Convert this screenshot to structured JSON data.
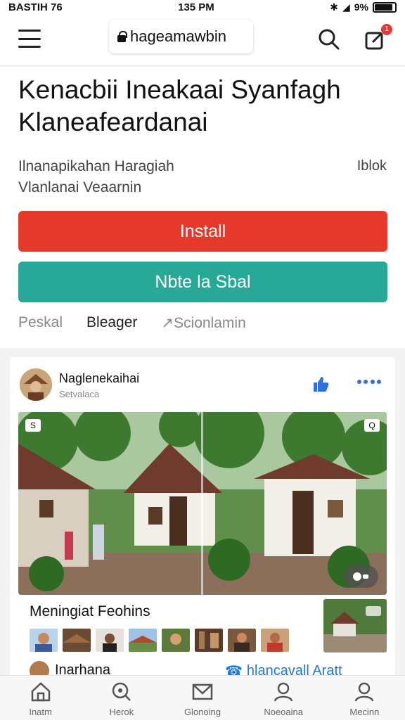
{
  "status_bar": {
    "left": "BASTIH 76",
    "time": "135 PM",
    "battery": "9%",
    "battery_level": 0.9
  },
  "app_bar": {
    "url": "hageamawbin",
    "notification_count": "1"
  },
  "hero": {
    "title": "Kenacbii Ineakaai Syanfagh Klaneafeardanai",
    "subtitle_line1": "Ilnanapikahan Haragiah",
    "subtitle_line2": "Vlanlanai Veaarnin",
    "side_link": "Iblok",
    "install_label": "Install",
    "secondary_label": "Nbte la Sbal",
    "tabs": [
      "Peskal",
      "Bleager",
      "Scionlamin"
    ]
  },
  "post": {
    "author": "Naglenekaihai",
    "author_sub": "Setvalaca",
    "photo_corner_left": "S",
    "photo_corner_right": "Q",
    "section_title": "Meningiat Feohins",
    "row_name": "Inarhana",
    "row_link": "hlancavall Aratt",
    "icons": [
      "like-icon",
      "more-icon",
      "video-icon"
    ]
  },
  "bottom_nav": [
    {
      "label": "Inatm",
      "icon": "home-icon"
    },
    {
      "label": "Herok",
      "icon": "search-icon"
    },
    {
      "label": "Glonoing",
      "icon": "mail-icon"
    },
    {
      "label": "Noeoaina",
      "icon": "user-icon"
    },
    {
      "label": "Mecinn",
      "icon": "profile-icon"
    }
  ],
  "colors": {
    "install": "#e53a2b",
    "secondary": "#28a897",
    "link": "#1e78d6",
    "badge": "#e53935"
  }
}
